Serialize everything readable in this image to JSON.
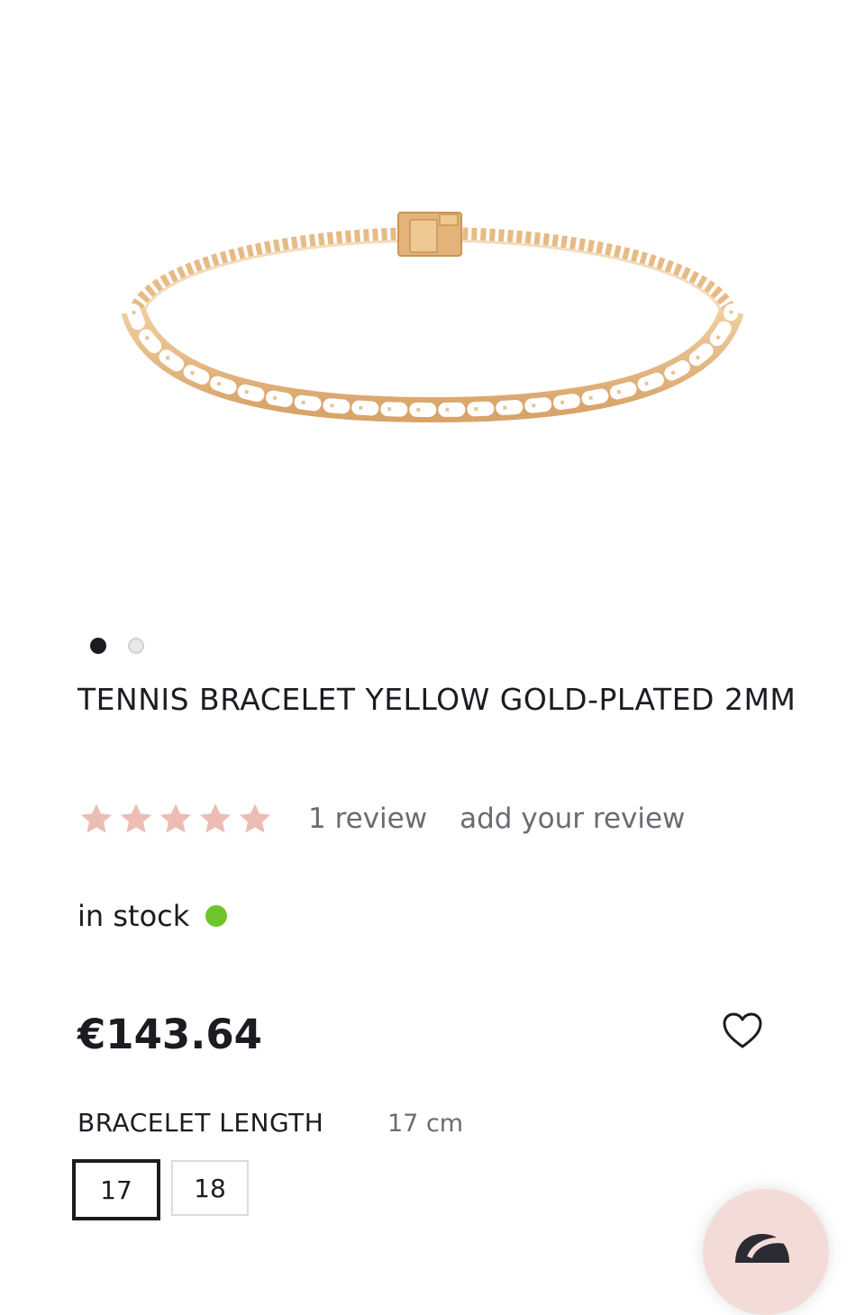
{
  "gallery": {
    "image_alt": "Tennis bracelet yellow gold-plated 2mm",
    "slides_total": 2,
    "active_slide": 1
  },
  "product": {
    "title": "TENNIS BRACELET YELLOW GOLD-PLATED 2MM",
    "rating": {
      "stars": 5,
      "max": 5,
      "review_count_label": "1 review",
      "add_review_label": "add your review",
      "star_color": "#ebbdb4"
    },
    "stock": {
      "label": "in stock",
      "indicator_color": "#6dc52b"
    },
    "price": "€143.64",
    "wishlist_icon": "heart-outline-icon"
  },
  "options": {
    "length_label": "BRACELET LENGTH",
    "selected_value": "17 cm",
    "sizes": [
      {
        "label": "17",
        "selected": true
      },
      {
        "label": "18",
        "selected": false
      }
    ]
  },
  "chat": {
    "icon": "chat-bubble-icon",
    "color": "#f3dcd8"
  },
  "colors": {
    "text": "#1b1b22",
    "muted": "#6b6b72",
    "gold": "#e2b67d"
  }
}
